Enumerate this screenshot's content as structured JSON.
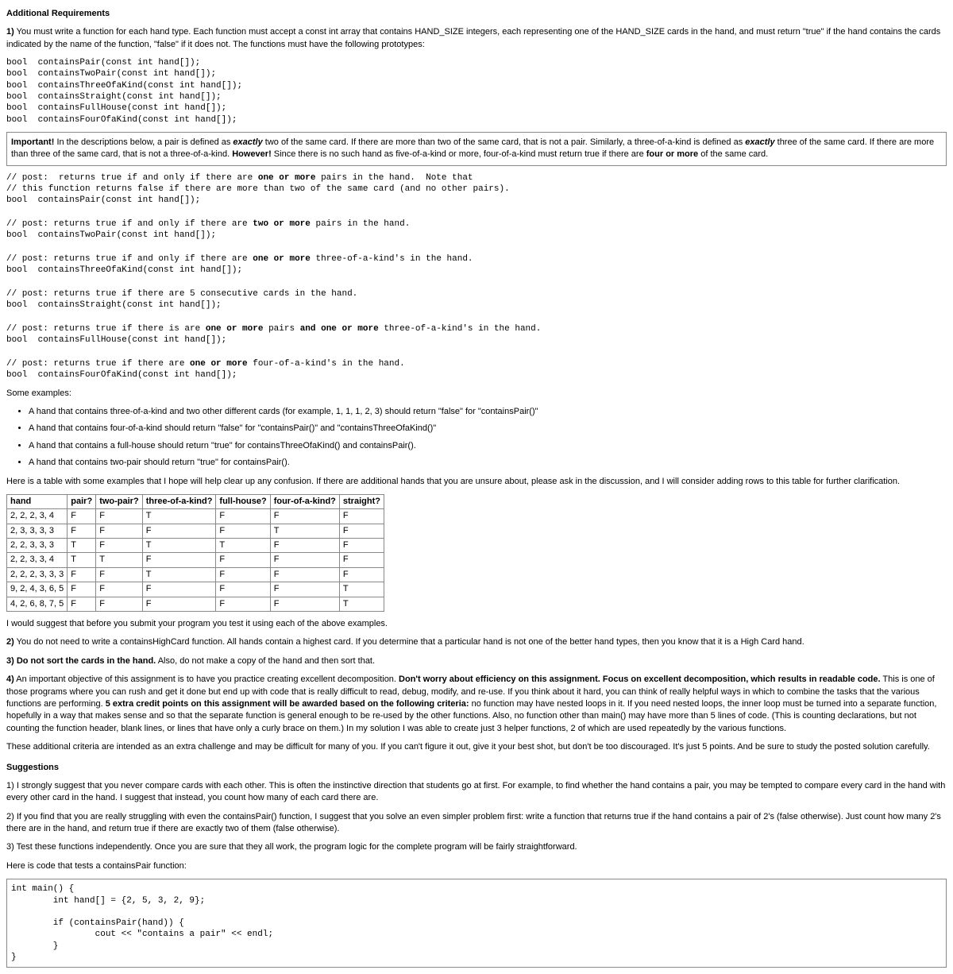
{
  "title": "Additional Requirements",
  "req1_label": "1)",
  "req1_text": " You must write a function for each hand type. Each function must accept a const int array that contains HAND_SIZE integers, each representing one of the HAND_SIZE cards in the hand, and must return \"true\" if the hand contains the cards indicated by the name of the function, \"false\" if it does not. The functions must have the following prototypes:",
  "prototypes": "bool  containsPair(const int hand[]);\nbool  containsTwoPair(const int hand[]);\nbool  containsThreeOfaKind(const int hand[]);\nbool  containsStraight(const int hand[]);\nbool  containsFullHouse(const int hand[]);\nbool  containsFourOfaKind(const int hand[]);",
  "important_label": "Important!",
  "important_pre": " In the descriptions below, a pair is defined as ",
  "exactly1": "exactly",
  "important_mid1": " two of the same card. If there are more than two of the same card, that is not a pair. Similarly, a three-of-a-kind is defined as ",
  "exactly2": "exactly",
  "important_mid2": " three of the same card. If there are more than three of the same card, that is not a three-of-a-kind. ",
  "however": "However!",
  "important_post": " Since there is no such hand as five-of-a-kind or more, four-of-a-kind must return true if there are ",
  "four_or_more": "four or more",
  "important_end": " of the same card.",
  "post1a": "// post:  returns true if and only if there are ",
  "one_or_more1": "one or more",
  "post1b": " pairs in the hand.  Note that\n// this function returns false if there are more than two of the same card (and no other pairs).\nbool  containsPair(const int hand[]);",
  "post2a": "// post: returns true if and only if there are ",
  "two_or_more": "two or more",
  "post2b": " pairs in the hand.\nbool  containsTwoPair(const int hand[]);",
  "post3a": "// post: returns true if and only if there are ",
  "one_or_more2": "one or more",
  "post3b": " three-of-a-kind's in the hand.\nbool  containsThreeOfaKind(const int hand[]);",
  "post4": "// post: returns true if there are 5 consecutive cards in the hand.\nbool  containsStraight(const int hand[]);",
  "post5a": "// post: returns true if there is are ",
  "one_or_more3": "one or more",
  "post5b": " pairs ",
  "and_one_or_more": "and one or more",
  "post5c": " three-of-a-kind's in the hand.\nbool  containsFullHouse(const int hand[]);",
  "post6a": "// post: returns true if there are ",
  "one_or_more4": "one or more",
  "post6b": " four-of-a-kind's in the hand.\nbool  containsFourOfaKind(const int hand[]);",
  "examples_label": "Some examples:",
  "ex1": "A hand that contains three-of-a-kind and two other different cards (for example, 1, 1, 1, 2, 3) should return \"false\" for \"containsPair()\"",
  "ex2": "A hand that contains four-of-a-kind should return \"false\" for \"containsPair()\" and \"containsThreeOfaKind()\"",
  "ex3": "A hand that contains a full-house should return \"true\" for containsThreeOfaKind() and containsPair().",
  "ex4": "A hand that contains two-pair should return \"true\" for containsPair().",
  "table_intro": "Here is a table with some examples that I hope will help clear up any confusion. If there are additional hands that you are unsure about, please ask in the discussion, and I will consider adding rows to this table for further clarification.",
  "th": [
    "hand",
    "pair?",
    "two-pair?",
    "three-of-a-kind?",
    "full-house?",
    "four-of-a-kind?",
    "straight?"
  ],
  "rows": [
    [
      "2, 2, 2, 3, 4",
      "F",
      "F",
      "T",
      "F",
      "F",
      "F"
    ],
    [
      "2, 3, 3, 3, 3",
      "F",
      "F",
      "F",
      "F",
      "T",
      "F"
    ],
    [
      "2, 2, 3, 3, 3",
      "T",
      "F",
      "T",
      "T",
      "F",
      "F"
    ],
    [
      "2, 2, 3, 3, 4",
      "T",
      "T",
      "F",
      "F",
      "F",
      "F"
    ],
    [
      "2, 2, 2, 3, 3, 3",
      "F",
      "F",
      "T",
      "F",
      "F",
      "F"
    ],
    [
      "9, 2, 4, 3, 6, 5",
      "F",
      "F",
      "F",
      "F",
      "F",
      "T"
    ],
    [
      "4, 2, 6, 8, 7, 5",
      "F",
      "F",
      "F",
      "F",
      "F",
      "T"
    ]
  ],
  "suggest_test": "I would suggest that before you submit your program you test it using each of the above examples.",
  "req2_label": "2)",
  "req2_text": " You do not need to write a containsHighCard function. All hands contain a highest card. If you determine that a particular hand is not one of the better hand types, then you know that it is a High Card hand.",
  "req3_label": "3)",
  "req3_bold": " Do not sort the cards in the hand.",
  "req3_text": " Also, do not make a copy of the hand and then sort that.",
  "req4_label": "4)",
  "req4_text1": " An important objective of this assignment is to have you practice creating excellent decomposition. ",
  "req4_bold1": "Don't worry about efficiency on this assignment. Focus on excellent decomposition, which results in readable code.",
  "req4_text2": " This is one of those programs where you can rush and get it done but end up with code that is really difficult to read, debug, modify, and re-use. If you think about it hard, you can think of really helpful ways in which to combine the tasks that the various functions are performing. ",
  "req4_bold2": "5 extra credit points on this assignment will be awarded based on the following criteria:",
  "req4_text3": " no function may have nested loops in it. If you need nested loops, the inner loop must be turned into a separate function, hopefully in a way that makes sense and so that the separate function is general enough to be re-used by the other functions. Also, no function other than main() may have more than 5 lines of code. (This is counting declarations, but not counting the function header, blank lines, or lines that have only a curly brace on them.) In my solution I was able to create just 3 helper functions, 2 of which are used repeatedly by the various functions.",
  "additional_criteria": "These additional criteria are intended as an extra challenge and may be difficult for many of you. If you can't figure it out, give it your best shot, but don't be too discouraged. It's just 5 points. And be sure to study the posted solution carefully.",
  "suggestions_title": "Suggestions",
  "sug1": "1) I strongly suggest that you never compare cards with each other. This is often the instinctive direction that students go at first. For example, to find whether the hand contains a pair, you may be tempted to compare every card in the hand with every other card in the hand. I suggest that instead, you count how many of each card there are.",
  "sug2": "2) If you find that you are really struggling with even the containsPair() function, I suggest that you solve an even simpler problem first: write a function that returns true if the hand contains a pair of 2's (false otherwise). Just count how many 2's there are in the hand, and return true if there are exactly two of them (false otherwise).",
  "sug3": "3) Test these functions independently. Once you are sure that they all work, the program logic for the complete program will be fairly straightforward.",
  "testcode_intro": "Here is code that tests a containsPair function:",
  "testcode": "int main() {\n        int hand[] = {2, 5, 3, 2, 9};\n\n        if (containsPair(hand)) {\n                cout << \"contains a pair\" << endl;\n        }\n}"
}
